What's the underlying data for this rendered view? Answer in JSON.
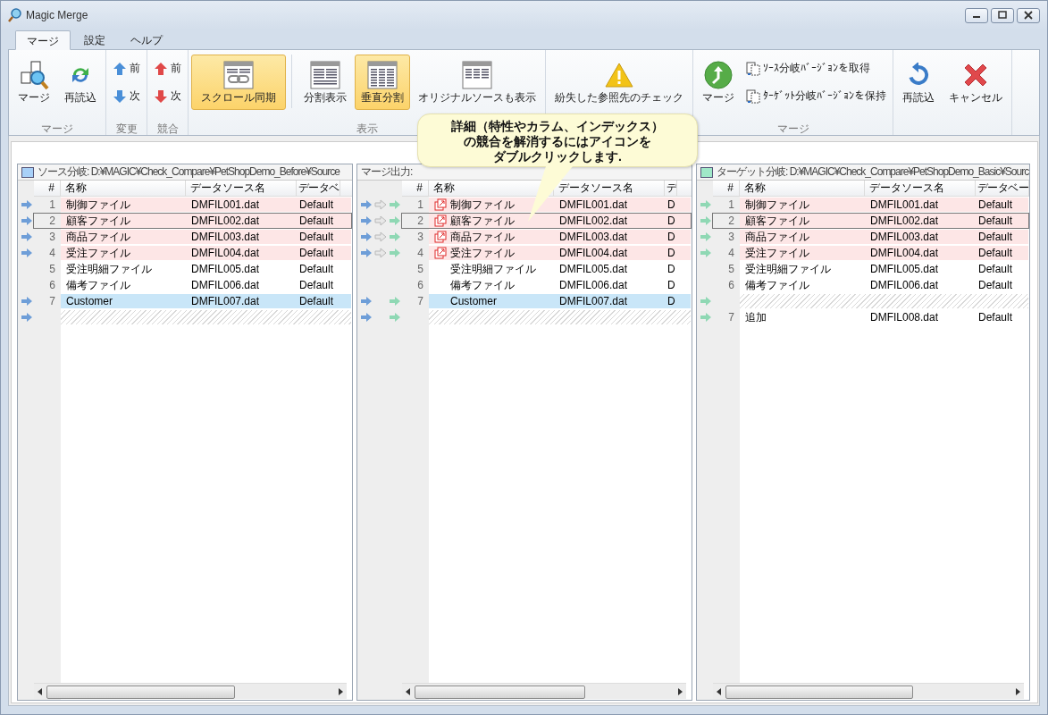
{
  "window": {
    "title": "Magic Merge"
  },
  "tabs": [
    {
      "label": "マージ",
      "selected": true
    },
    {
      "label": "設定",
      "selected": false
    },
    {
      "label": "ヘルプ",
      "selected": false
    }
  ],
  "ribbon": {
    "groups": [
      {
        "label": "マージ",
        "items": [
          {
            "kind": "docsearch",
            "label": "マージ"
          },
          {
            "kind": "reload",
            "label": "再読込"
          }
        ]
      },
      {
        "label": "変更",
        "items": [
          {
            "kind": "changeprev",
            "label": "前"
          },
          {
            "kind": "changenext",
            "label": "次"
          }
        ]
      },
      {
        "label": "競合",
        "items": [
          {
            "kind": "conflictprev",
            "label": "前"
          },
          {
            "kind": "conflictnext",
            "label": "次"
          }
        ]
      },
      {
        "label": "表示",
        "items": [
          {
            "kind": "sync",
            "label": "スクロール同期",
            "selected": true
          },
          {
            "kind": "split",
            "label": "分割表示",
            "selected": false
          },
          {
            "kind": "vertical",
            "label": "垂直分割",
            "selected": true
          },
          {
            "kind": "original",
            "label": "オリジナルソースも表示",
            "selected": false
          }
        ]
      },
      {
        "items": [
          {
            "kind": "warning",
            "label": "紛失した参照先のチェック"
          }
        ]
      },
      {
        "label": "マージ",
        "items": [
          {
            "kind": "mergego",
            "label": "マージ"
          },
          {
            "kind": "getsource",
            "label": "ｿｰｽ分岐ﾊﾞｰｼﾞｮﾝを取得"
          },
          {
            "kind": "keeptarget",
            "label": "ﾀｰｹﾞｯﾄ分岐ﾊﾞｰｼﾞｮﾝを保持"
          }
        ]
      },
      {
        "items": [
          {
            "kind": "refresh",
            "label": "再読込"
          },
          {
            "kind": "cancel",
            "label": "キャンセル"
          }
        ]
      }
    ]
  },
  "tooltip": {
    "lines": [
      "詳細（特性やカラム、インデックス）",
      "の競合を解消するにはアイコンを",
      "ダブルクリックします."
    ]
  },
  "panes": [
    {
      "title": "ソース分岐: D:¥MAGIC¥Check_Compare¥PetShopDemo_Before¥Source",
      "color": "#a8d0f8",
      "columns": [
        "#",
        "名称",
        "データソース名",
        "データベ"
      ],
      "rows": [
        {
          "kind": "row",
          "source_arrow": true,
          "number": "1",
          "name": "制御ファイル",
          "data_source": "DMFIL001.dat",
          "column_4": "Default",
          "conflict": true,
          "added": false,
          "selected": false
        },
        {
          "kind": "row",
          "source_arrow": true,
          "number": "2",
          "name": "顧客ファイル",
          "data_source": "DMFIL002.dat",
          "column_4": "Default",
          "conflict": true,
          "added": false,
          "selected": true
        },
        {
          "kind": "row",
          "source_arrow": true,
          "number": "3",
          "name": "商品ファイル",
          "data_source": "DMFIL003.dat",
          "column_4": "Default",
          "conflict": true,
          "added": false,
          "selected": false
        },
        {
          "kind": "row",
          "source_arrow": true,
          "number": "4",
          "name": "受注ファイル",
          "data_source": "DMFIL004.dat",
          "column_4": "Default",
          "conflict": true,
          "added": false,
          "selected": false
        },
        {
          "kind": "row",
          "source_arrow": false,
          "number": "5",
          "name": "受注明細ファイル",
          "data_source": "DMFIL005.dat",
          "column_4": "Default",
          "conflict": false,
          "added": false,
          "selected": false
        },
        {
          "kind": "row",
          "source_arrow": false,
          "number": "6",
          "name": "備考ファイル",
          "data_source": "DMFIL006.dat",
          "column_4": "Default",
          "conflict": false,
          "added": false,
          "selected": false
        },
        {
          "kind": "row",
          "source_arrow": true,
          "number": "7",
          "name": "Customer",
          "data_source": "DMFIL007.dat",
          "column_4": "Default",
          "conflict": false,
          "added": true,
          "selected": false
        },
        {
          "kind": "placeholder",
          "source_arrow": true,
          "selected": false
        }
      ]
    },
    {
      "title": "マージ出力:",
      "columns": [
        "#",
        "名称",
        "データソース名",
        "デ"
      ],
      "rows": [
        {
          "kind": "row",
          "source_arrow": true,
          "skip_arrow": true,
          "target_arrow": true,
          "conflict_icon": true,
          "number": "1",
          "name": "制御ファイル",
          "data_source": "DMFIL001.dat",
          "column_4": "D",
          "conflict": true,
          "added": false,
          "selected": false
        },
        {
          "kind": "row",
          "source_arrow": true,
          "skip_arrow": true,
          "target_arrow": true,
          "conflict_icon": true,
          "number": "2",
          "name": "顧客ファイル",
          "data_source": "DMFIL002.dat",
          "column_4": "D",
          "conflict": true,
          "added": false,
          "selected": true
        },
        {
          "kind": "row",
          "source_arrow": true,
          "skip_arrow": true,
          "target_arrow": true,
          "conflict_icon": true,
          "number": "3",
          "name": "商品ファイル",
          "data_source": "DMFIL003.dat",
          "column_4": "D",
          "conflict": true,
          "added": false,
          "selected": false
        },
        {
          "kind": "row",
          "source_arrow": true,
          "skip_arrow": true,
          "target_arrow": true,
          "conflict_icon": true,
          "number": "4",
          "name": "受注ファイル",
          "data_source": "DMFIL004.dat",
          "column_4": "D",
          "conflict": true,
          "added": false,
          "selected": false
        },
        {
          "kind": "row",
          "source_arrow": false,
          "skip_arrow": false,
          "target_arrow": false,
          "conflict_icon": false,
          "number": "5",
          "name": "受注明細ファイル",
          "data_source": "DMFIL005.dat",
          "column_4": "D",
          "conflict": false,
          "added": false,
          "selected": false
        },
        {
          "kind": "row",
          "source_arrow": false,
          "skip_arrow": false,
          "target_arrow": false,
          "conflict_icon": false,
          "number": "6",
          "name": "備考ファイル",
          "data_source": "DMFIL006.dat",
          "column_4": "D",
          "conflict": false,
          "added": false,
          "selected": false
        },
        {
          "kind": "row",
          "source_arrow": true,
          "skip_arrow": false,
          "target_arrow": true,
          "conflict_icon": false,
          "number": "7",
          "name": "Customer",
          "data_source": "DMFIL007.dat",
          "column_4": "D",
          "conflict": false,
          "added": true,
          "selected": false
        },
        {
          "kind": "placeholder",
          "source_arrow": true,
          "skip_arrow": false,
          "target_arrow": true,
          "selected": false
        }
      ]
    },
    {
      "title": "ターゲット分岐: D:¥MAGIC¥Check_Compare¥PetShopDemo_Basic¥Sourc",
      "color": "#a0e8c8",
      "columns": [
        "#",
        "名称",
        "データソース名",
        "データベー"
      ],
      "rows": [
        {
          "kind": "row",
          "target_arrow": true,
          "number": "1",
          "name": "制御ファイル",
          "data_source": "DMFIL001.dat",
          "column_4": "Default",
          "conflict": true,
          "added": false,
          "selected": false
        },
        {
          "kind": "row",
          "target_arrow": true,
          "number": "2",
          "name": "顧客ファイル",
          "data_source": "DMFIL002.dat",
          "column_4": "Default",
          "conflict": true,
          "added": false,
          "selected": true
        },
        {
          "kind": "row",
          "target_arrow": true,
          "number": "3",
          "name": "商品ファイル",
          "data_source": "DMFIL003.dat",
          "column_4": "Default",
          "conflict": true,
          "added": false,
          "selected": false
        },
        {
          "kind": "row",
          "target_arrow": true,
          "number": "4",
          "name": "受注ファイル",
          "data_source": "DMFIL004.dat",
          "column_4": "Default",
          "conflict": true,
          "added": false,
          "selected": false
        },
        {
          "kind": "row",
          "target_arrow": false,
          "number": "5",
          "name": "受注明細ファイル",
          "data_source": "DMFIL005.dat",
          "column_4": "Default",
          "conflict": false,
          "added": false,
          "selected": false
        },
        {
          "kind": "row",
          "target_arrow": false,
          "number": "6",
          "name": "備考ファイル",
          "data_source": "DMFIL006.dat",
          "column_4": "Default",
          "conflict": false,
          "added": false,
          "selected": false
        },
        {
          "kind": "placeholder",
          "target_arrow": true,
          "selected": false
        },
        {
          "kind": "row",
          "target_arrow": true,
          "number": "7",
          "name": "追加",
          "data_source": "DMFIL008.dat",
          "column_4": "Default",
          "conflict": false,
          "added": false,
          "selected": false
        }
      ]
    }
  ]
}
